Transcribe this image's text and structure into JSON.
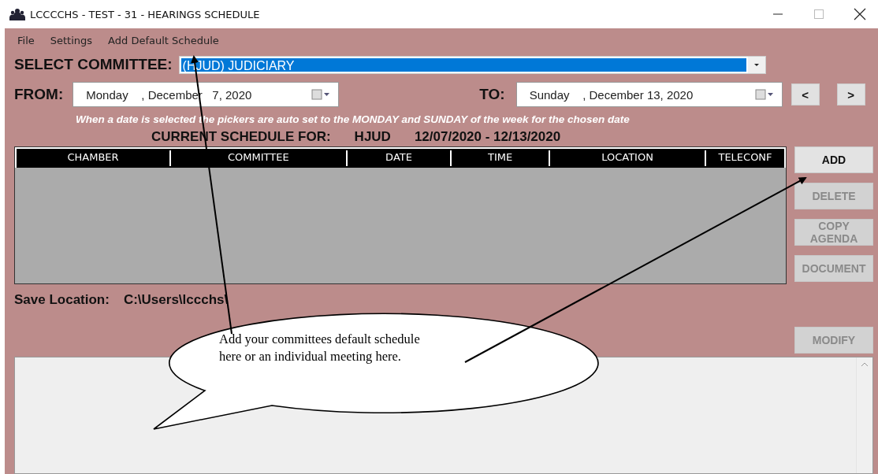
{
  "window": {
    "title": "LCCCCHS - TEST - 31 - HEARINGS SCHEDULE"
  },
  "menu": [
    "File",
    "Settings",
    "Add Default Schedule"
  ],
  "committee": {
    "label": "SELECT COMMITTEE:",
    "value": "(HJUD) JUDICIARY"
  },
  "from": {
    "label": "FROM:",
    "value": "Monday    , December   7, 2020"
  },
  "to": {
    "label": "TO:",
    "value": "Sunday    , December 13, 2020"
  },
  "nav_buttons": [
    "<",
    ">"
  ],
  "hint": "When a date is selected the pickers are auto set to the MONDAY and SUNDAY of the week for the chosen date",
  "schedule_heading": {
    "label": "CURRENT SCHEDULE FOR:",
    "committee": "HJUD",
    "range": "12/07/2020 - 12/13/2020"
  },
  "table": {
    "columns": [
      "CHAMBER",
      "COMMITTEE",
      "DATE",
      "TIME",
      "LOCATION",
      "TELECONF"
    ]
  },
  "buttons": [
    {
      "label": "ADD",
      "disabled": false
    },
    {
      "label": "DELETE",
      "disabled": true
    },
    {
      "label": "COPY AGENDA",
      "disabled": true
    },
    {
      "label": "DOCUMENT",
      "disabled": true
    }
  ],
  "save_location": {
    "label": "Save Location:",
    "value": "C:\\Users\\lccchs\\"
  },
  "modify_button": {
    "label": "MODIFY",
    "disabled": true
  },
  "callout": {
    "lines": [
      "Add your committees default schedule",
      "here or an individual meeting here."
    ]
  }
}
